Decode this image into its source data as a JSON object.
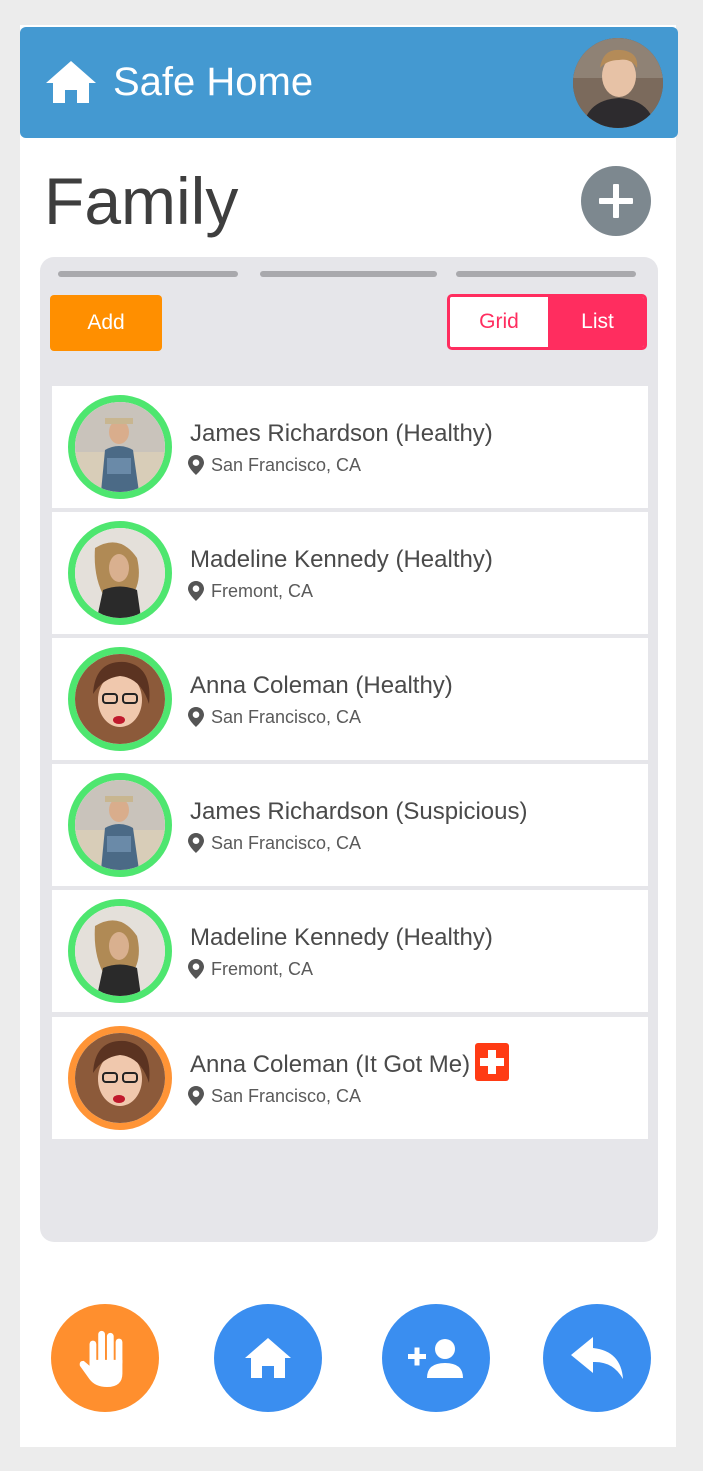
{
  "header": {
    "title": "Safe Home",
    "avatar_alt": "user profile"
  },
  "page": {
    "title": "Family"
  },
  "toolbar": {
    "add_label": "Add",
    "grid_label": "Grid",
    "list_label": "List",
    "selected_view": "List"
  },
  "members": [
    {
      "name": "James Richardson (Healthy)",
      "location": "San Francisco, CA",
      "status": "healthy",
      "photo": "man-hat"
    },
    {
      "name": "Madeline Kennedy (Healthy)",
      "location": "Fremont, CA",
      "status": "healthy",
      "photo": "woman-blonde"
    },
    {
      "name": "Anna Coleman (Healthy)",
      "location": "San Francisco, CA",
      "status": "healthy",
      "photo": "woman-glasses"
    },
    {
      "name": "James Richardson (Suspicious)",
      "location": "San Francisco, CA",
      "status": "healthy",
      "photo": "man-hat"
    },
    {
      "name": "Madeline Kennedy (Healthy)",
      "location": "Fremont, CA",
      "status": "healthy",
      "photo": "woman-blonde"
    },
    {
      "name": "Anna Coleman (It Got Me)",
      "location": "San Francisco, CA",
      "status": "alert",
      "photo": "woman-glasses",
      "badge": "medical-cross-icon"
    }
  ],
  "colors": {
    "header": "#4499d1",
    "healthy_ring": "#4ee66f",
    "alert_ring": "#ff9436",
    "toggle_accent": "#ff2d5f",
    "add_button": "#ff8f00",
    "fab_blue": "#3a8ef0",
    "fab_orange": "#ff8f2e"
  },
  "bottom_nav": [
    {
      "icon": "hand-stop-icon",
      "color": "#ff8f2e"
    },
    {
      "icon": "home-icon",
      "color": "#3a8ef0"
    },
    {
      "icon": "add-person-icon",
      "color": "#3a8ef0"
    },
    {
      "icon": "reply-arrow-icon",
      "color": "#3a8ef0"
    }
  ]
}
